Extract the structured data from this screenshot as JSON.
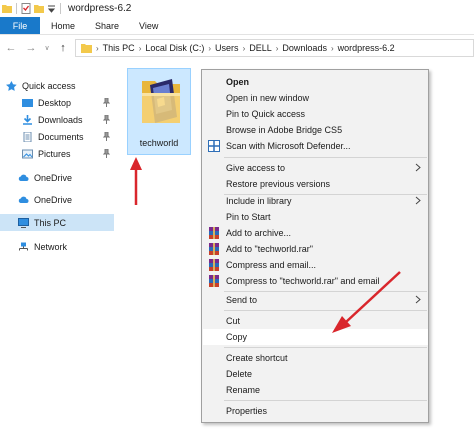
{
  "window": {
    "title": "wordpress-6.2"
  },
  "ribbon": {
    "tabs": [
      "File",
      "Home",
      "Share",
      "View"
    ]
  },
  "address": {
    "crumbs": [
      "This PC",
      "Local Disk (C:)",
      "Users",
      "DELL",
      "Downloads",
      "wordpress-6.2"
    ]
  },
  "nav": {
    "items": [
      {
        "label": "Quick access",
        "icon": "star-icon"
      },
      {
        "label": "Desktop",
        "icon": "desktop-icon",
        "pinned": true
      },
      {
        "label": "Downloads",
        "icon": "download-icon",
        "pinned": true
      },
      {
        "label": "Documents",
        "icon": "documents-icon",
        "pinned": true
      },
      {
        "label": "Pictures",
        "icon": "pictures-icon",
        "pinned": true
      },
      {
        "label": "OneDrive",
        "icon": "cloud-icon"
      },
      {
        "label": "OneDrive",
        "icon": "cloud-icon"
      },
      {
        "label": "This PC",
        "icon": "computer-icon",
        "selected": true
      },
      {
        "label": "Network",
        "icon": "network-icon"
      }
    ]
  },
  "content": {
    "folder_name": "techworld"
  },
  "context_menu": {
    "items": [
      {
        "label": "Open",
        "bold": true
      },
      {
        "label": "Open in new window"
      },
      {
        "label": "Pin to Quick access"
      },
      {
        "label": "Browse in Adobe Bridge CS5"
      },
      {
        "label": "Scan with Microsoft Defender...",
        "icon": "defender-icon"
      },
      {
        "label": "Give access to",
        "submenu": true
      },
      {
        "label": "Restore previous versions"
      },
      {
        "label": "Include in library",
        "submenu": true
      },
      {
        "label": "Pin to Start"
      },
      {
        "label": "Add to archive...",
        "icon": "winrar-icon"
      },
      {
        "label": "Add to \"techworld.rar\"",
        "icon": "winrar-icon"
      },
      {
        "label": "Compress and email...",
        "icon": "winrar-icon"
      },
      {
        "label": "Compress to \"techworld.rar\" and email",
        "icon": "winrar-icon"
      },
      {
        "label": "Send to",
        "submenu": true
      },
      {
        "label": "Cut"
      },
      {
        "label": "Copy",
        "highlighted": true
      },
      {
        "label": "Create shortcut"
      },
      {
        "label": "Delete"
      },
      {
        "label": "Rename"
      },
      {
        "label": "Properties"
      }
    ]
  },
  "colors": {
    "accent": "#1979ca",
    "selection": "#cce8ff",
    "annotation": "#d9262c"
  }
}
